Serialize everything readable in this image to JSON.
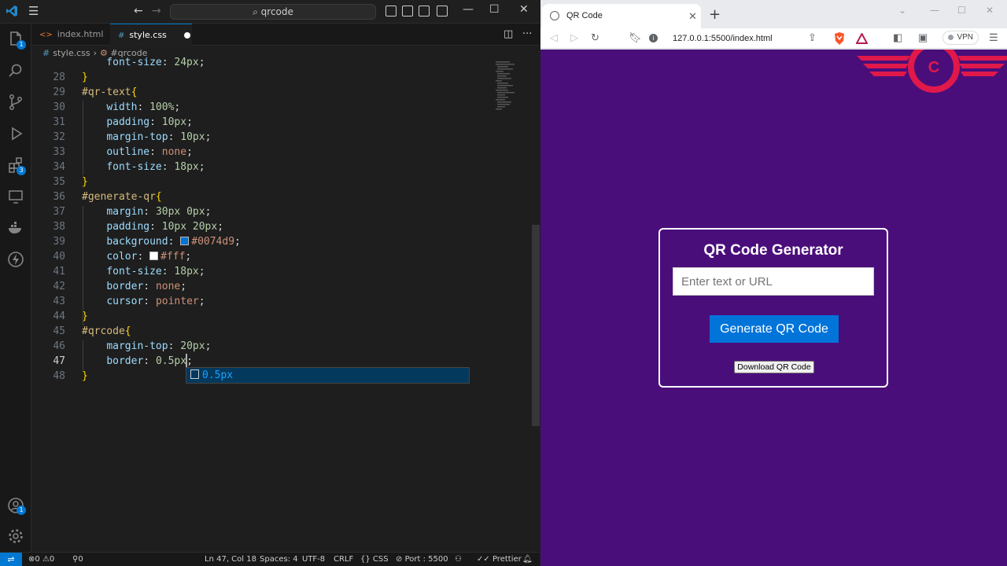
{
  "vscode": {
    "search": "qrcode",
    "tabs": [
      {
        "label": "index.html",
        "icon": "html-icon"
      },
      {
        "label": "style.css",
        "icon": "css-icon",
        "modified": true
      }
    ],
    "breadcrumb": {
      "file": "style.css",
      "symbol": "#qrcode"
    },
    "lines": [
      {
        "n": "28",
        "text": "}"
      },
      {
        "n": "29",
        "text": "#qr-text{"
      },
      {
        "n": "30",
        "prop": "width",
        "value": "100%"
      },
      {
        "n": "31",
        "prop": "padding",
        "value": "10px"
      },
      {
        "n": "32",
        "prop": "margin-top",
        "value": "10px"
      },
      {
        "n": "33",
        "prop": "outline",
        "value": "none"
      },
      {
        "n": "34",
        "prop": "font-size",
        "value": "18px"
      },
      {
        "n": "35",
        "text": "}"
      },
      {
        "n": "36",
        "text": "#generate-qr{"
      },
      {
        "n": "37",
        "prop": "margin",
        "value": "30px 0px"
      },
      {
        "n": "38",
        "prop": "padding",
        "value": "10px 20px"
      },
      {
        "n": "39",
        "prop": "background",
        "value": "#0074d9",
        "swatch": "#0074d9"
      },
      {
        "n": "40",
        "prop": "color",
        "value": "#fff",
        "swatch": "#ffffff"
      },
      {
        "n": "41",
        "prop": "font-size",
        "value": "18px"
      },
      {
        "n": "42",
        "prop": "border",
        "value": "none"
      },
      {
        "n": "43",
        "prop": "cursor",
        "value": "pointer"
      },
      {
        "n": "44",
        "text": "}"
      },
      {
        "n": "45",
        "text": "#qrcode{"
      },
      {
        "n": "46",
        "prop": "margin-top",
        "value": "20px"
      },
      {
        "n": "47",
        "prop": "border",
        "value": "0.5px"
      },
      {
        "n": "48",
        "text": "}"
      }
    ],
    "suggestion": "0.5px",
    "status": {
      "errors": "0",
      "warnings": "0",
      "ports": "0",
      "position": "Ln 47, Col 18",
      "spaces": "Spaces: 4",
      "encoding": "UTF-8",
      "eol": "CRLF",
      "language": "CSS",
      "port": "Port : 5500",
      "prettier": "Prettier"
    },
    "badges": {
      "explorer": "1",
      "extensions": "3",
      "account": "1"
    }
  },
  "browser": {
    "tab_title": "QR Code",
    "url": "127.0.0.1:5500/index.html",
    "vpn": "VPN",
    "logo_letter": "C",
    "page": {
      "title": "QR Code Generator",
      "input_placeholder": "Enter text or URL",
      "generate_label": "Generate QR Code",
      "download_label": "Download QR Code"
    }
  },
  "colors": {
    "page_bg": "#4a0e7b",
    "button_bg": "#0074d9",
    "logo": "#e0194a",
    "vscode_accent": "#0078d4"
  }
}
